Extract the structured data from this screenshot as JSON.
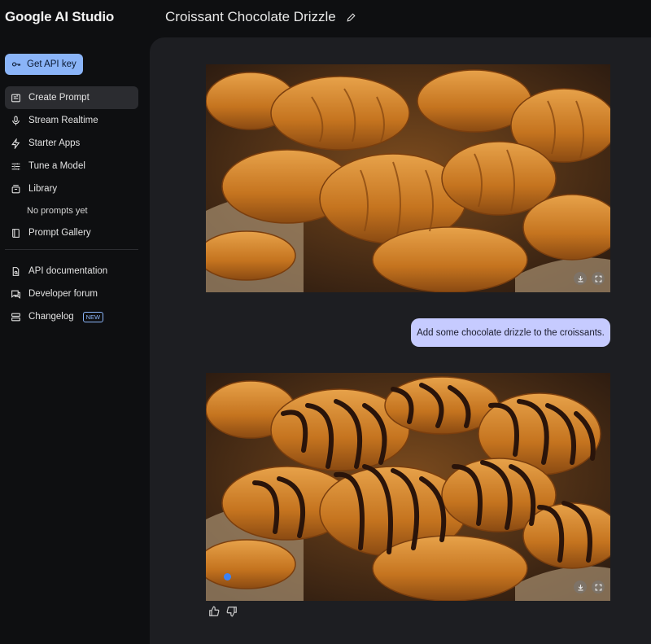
{
  "app": {
    "brand": "Google AI Studio",
    "page_title": "Croissant Chocolate Drizzle"
  },
  "sidebar": {
    "api_key_label": "Get API key",
    "items": [
      {
        "label": "Create Prompt",
        "icon": "create-prompt-icon",
        "active": true
      },
      {
        "label": "Stream Realtime",
        "icon": "microphone-icon"
      },
      {
        "label": "Starter Apps",
        "icon": "bolt-icon"
      },
      {
        "label": "Tune a Model",
        "icon": "tune-icon"
      },
      {
        "label": "Library",
        "icon": "library-icon"
      }
    ],
    "library_empty": "No prompts yet",
    "gallery_label": "Prompt Gallery",
    "links": [
      {
        "label": "API documentation",
        "icon": "doc-search-icon"
      },
      {
        "label": "Developer forum",
        "icon": "forum-icon"
      },
      {
        "label": "Changelog",
        "icon": "changelog-icon",
        "badge": "NEW"
      }
    ]
  },
  "chat": {
    "user_message": "Add some chocolate drizzle to the croissants."
  },
  "colors": {
    "accent": "#8ab4f8",
    "user_bubble": "#c6cbff",
    "panel": "#1d1e22",
    "background": "#0e0f11"
  }
}
